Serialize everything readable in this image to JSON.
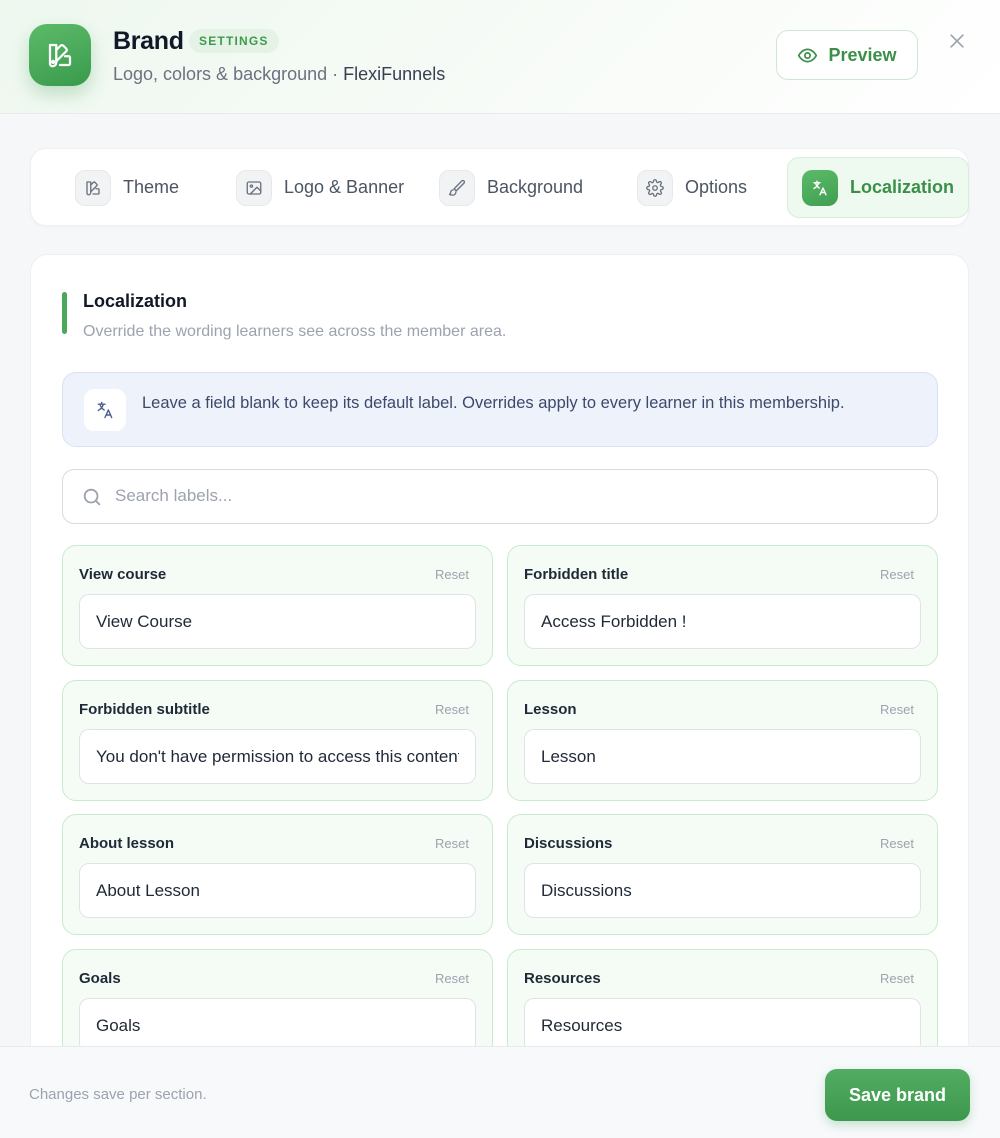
{
  "header": {
    "title": "Brand",
    "badge": "SETTINGS",
    "subtitle": "Logo, colors & background ·",
    "org": "FlexiFunnels",
    "preview_label": "Preview"
  },
  "tabs": [
    {
      "label": "Theme",
      "icon": "theme-icon"
    },
    {
      "label": "Logo & Banner",
      "icon": "image-icon"
    },
    {
      "label": "Background",
      "icon": "brush-icon"
    },
    {
      "label": "Options",
      "icon": "gear-icon"
    },
    {
      "label": "Localization",
      "icon": "translate-icon",
      "active": true
    }
  ],
  "section": {
    "title": "Localization",
    "subtitle": "Override the wording learners see across the member area."
  },
  "info": {
    "text": "Leave a field blank to keep its default label. Overrides apply to every learner in this membership."
  },
  "search": {
    "placeholder": "Search labels..."
  },
  "fields": [
    {
      "label": "View course",
      "reset": "Reset",
      "value": "View Course"
    },
    {
      "label": "Forbidden title",
      "reset": "Reset",
      "value": "Access Forbidden !"
    },
    {
      "label": "Forbidden subtitle",
      "reset": "Reset",
      "value": "You don't have permission to access this content"
    },
    {
      "label": "Lesson",
      "reset": "Reset",
      "value": "Lesson"
    },
    {
      "label": "About lesson",
      "reset": "Reset",
      "value": "About Lesson"
    },
    {
      "label": "Discussions",
      "reset": "Reset",
      "value": "Discussions"
    },
    {
      "label": "Goals",
      "reset": "Reset",
      "value": "Goals"
    },
    {
      "label": "Resources",
      "reset": "Reset",
      "value": "Resources"
    }
  ],
  "footer": {
    "note": "Changes save per section.",
    "save_label": "Save brand"
  },
  "colors": {
    "accent": "#4aa85a",
    "accent_light": "#eef9ef",
    "info_bg": "#eef2fb"
  }
}
